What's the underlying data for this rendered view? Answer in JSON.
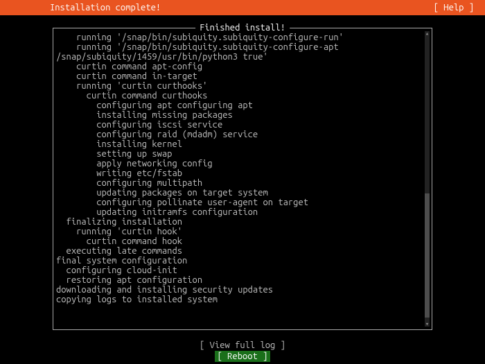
{
  "header": {
    "title": "Installation complete!",
    "help": "[ Help ]"
  },
  "log": {
    "box_title": " Finished install! ",
    "lines": [
      "    running '/snap/bin/subiquity.subiquity-configure-run'",
      "    running '/snap/bin/subiquity.subiquity-configure-apt",
      "/snap/subiquity/1459/usr/bin/python3 true'",
      "    curtin command apt-config",
      "    curtin command in-target",
      "    running 'curtin curthooks'",
      "      curtin command curthooks",
      "        configuring apt configuring apt",
      "        installing missing packages",
      "        configuring iscsi service",
      "        configuring raid (mdadm) service",
      "        installing kernel",
      "        setting up swap",
      "        apply networking config",
      "        writing etc/fstab",
      "        configuring multipath",
      "        updating packages on target system",
      "        configuring pollinate user-agent on target",
      "        updating initramfs configuration",
      "  finalizing installation",
      "    running 'curtin hook'",
      "      curtin command hook",
      "  executing late commands",
      "final system configuration",
      "  configuring cloud-init",
      "  restoring apt configuration",
      "downloading and installing security updates",
      "copying logs to installed system"
    ]
  },
  "footer": {
    "view_full_log": "[ View full log ]",
    "reboot": "[ Reboot       ]"
  }
}
